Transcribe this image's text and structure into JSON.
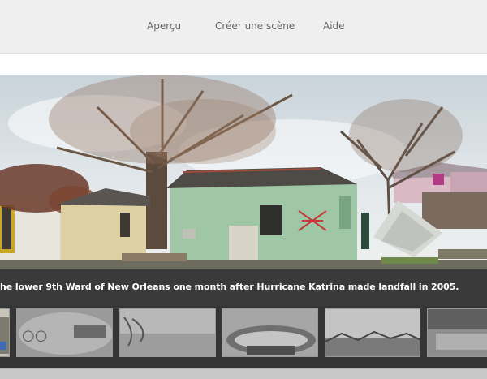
{
  "nav": {
    "items": [
      {
        "label": "Aperçu"
      },
      {
        "label": "Créer une scène"
      },
      {
        "label": "Aide"
      }
    ]
  },
  "caption": {
    "text": "he lower 9th Ward of New Orleans one month after Hurricane Katrina made landfall in 2005."
  },
  "colors": {
    "topbar": "#efefef",
    "caption_band": "#3a3a3a",
    "filmstrip": "#353535",
    "house_green": "#9fc7a6",
    "roof": "#4e4a45"
  }
}
